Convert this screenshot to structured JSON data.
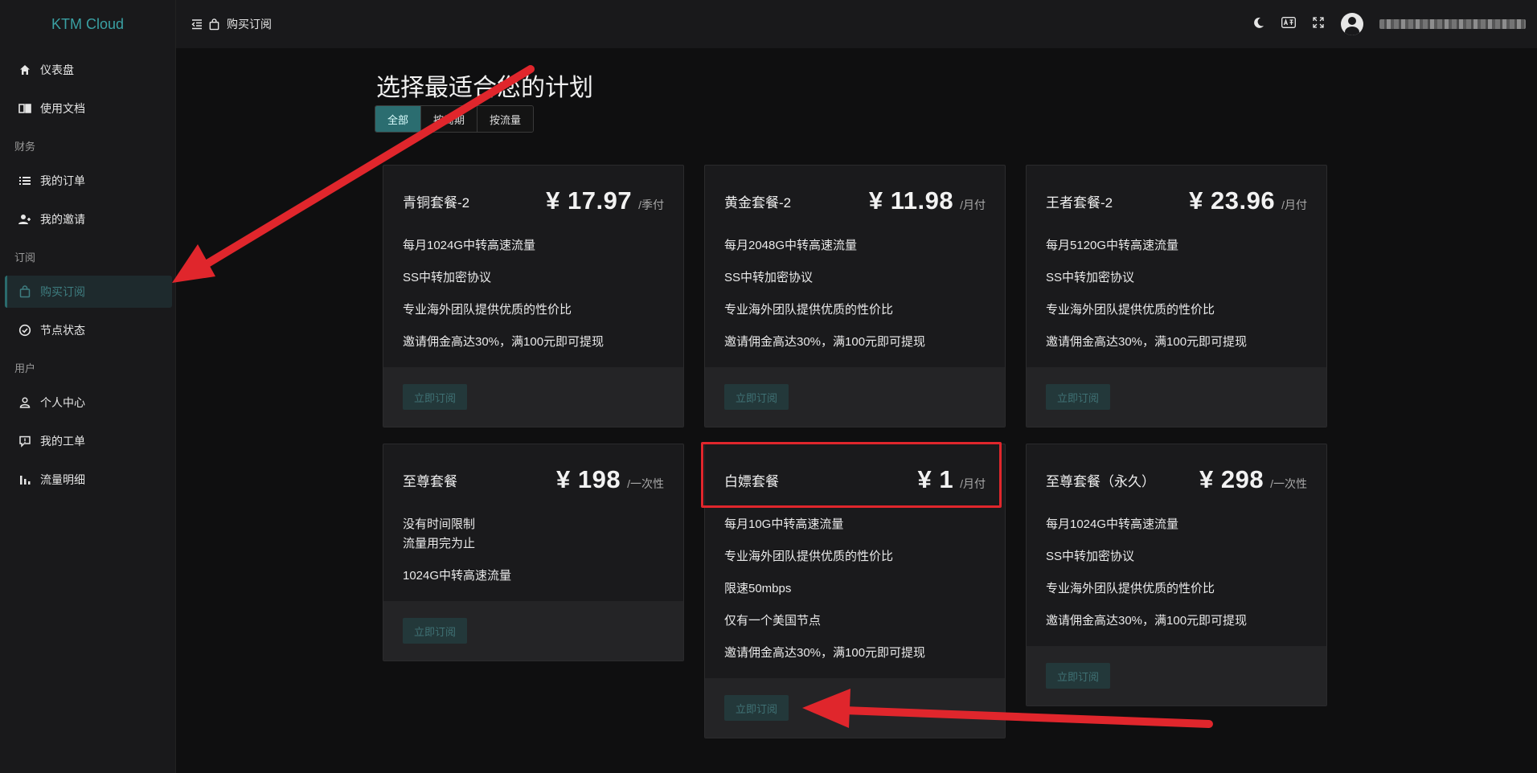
{
  "brand": "KTM Cloud",
  "sidebar": {
    "items": [
      {
        "label": "仪表盘",
        "icon": "home-icon"
      },
      {
        "label": "使用文档",
        "icon": "book-icon"
      },
      {
        "section": "财务"
      },
      {
        "label": "我的订单",
        "icon": "list-icon"
      },
      {
        "label": "我的邀请",
        "icon": "users-icon"
      },
      {
        "section": "订阅"
      },
      {
        "label": "购买订阅",
        "icon": "bag-icon",
        "active": true
      },
      {
        "label": "节点状态",
        "icon": "check-circle-icon"
      },
      {
        "section": "用户"
      },
      {
        "label": "个人中心",
        "icon": "user-icon"
      },
      {
        "label": "我的工单",
        "icon": "ticket-icon"
      },
      {
        "label": "流量明细",
        "icon": "bar-chart-icon"
      }
    ]
  },
  "header": {
    "breadcrumb": "购买订阅",
    "icons": [
      "moon-icon",
      "translate-icon",
      "fullscreen-icon",
      "avatar"
    ]
  },
  "main": {
    "title": "选择最适合您的计划",
    "filters": [
      {
        "label": "全部",
        "active": true
      },
      {
        "label": "按周期"
      },
      {
        "label": "按流量"
      }
    ],
    "subscribe_label": "立即订阅",
    "plans": [
      {
        "name": "青铜套餐-2",
        "price": "¥ 17.97",
        "unit": "/季付",
        "features": [
          "每月1024G中转高速流量",
          "SS中转加密协议",
          "专业海外团队提供优质的性价比",
          "邀请佣金高达30%，满100元即可提现"
        ]
      },
      {
        "name": "黄金套餐-2",
        "price": "¥ 11.98",
        "unit": "/月付",
        "features": [
          "每月2048G中转高速流量",
          "SS中转加密协议",
          "专业海外团队提供优质的性价比",
          "邀请佣金高达30%，满100元即可提现"
        ]
      },
      {
        "name": "王者套餐-2",
        "price": "¥ 23.96",
        "unit": "/月付",
        "features": [
          "每月5120G中转高速流量",
          "SS中转加密协议",
          "专业海外团队提供优质的性价比",
          "邀请佣金高达30%，满100元即可提现"
        ]
      },
      {
        "name": "至尊套餐",
        "price": "¥ 198",
        "unit": "/一次性",
        "features": [
          "没有时间限制\n流量用完为止",
          "1024G中转高速流量"
        ]
      },
      {
        "name": "白嫖套餐",
        "price": "¥ 1",
        "unit": "/月付",
        "features": [
          "每月10G中转高速流量",
          "专业海外团队提供优质的性价比",
          "限速50mbps",
          "仅有一个美国节点",
          "邀请佣金高达30%，满100元即可提现"
        ]
      },
      {
        "name": "至尊套餐（永久）",
        "price": "¥ 298",
        "unit": "/一次性",
        "features": [
          "每月1024G中转高速流量",
          "SS中转加密协议",
          "专业海外团队提供优质的性价比",
          "邀请佣金高达30%，满100元即可提现"
        ]
      }
    ]
  },
  "colors": {
    "accent": "#2b6d70",
    "annotation": "#e0262c"
  }
}
